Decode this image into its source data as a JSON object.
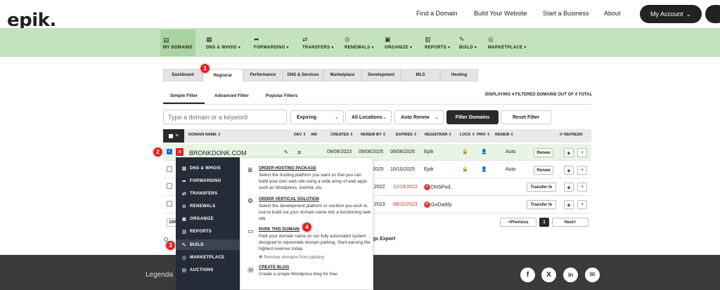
{
  "header": {
    "logo": "epik.",
    "links": [
      "Find a Domain",
      "Build Your Website",
      "Start a Business",
      "About"
    ],
    "account_button": "My Account",
    "account_chevron": "⌄"
  },
  "nav": {
    "items": [
      {
        "label": "MY DOMAINS",
        "icon": "▤"
      },
      {
        "label": "DNS & WHOIS ▾",
        "icon": "▦"
      },
      {
        "label": "FORWARDING ▾",
        "icon": "➦"
      },
      {
        "label": "TRANSFERS ▾",
        "icon": "⇄"
      },
      {
        "label": "RENEWALS ▾",
        "icon": "⊙"
      },
      {
        "label": "ORGANIZE ▾",
        "icon": "▣"
      },
      {
        "label": "REPORTS ▾",
        "icon": "▥"
      },
      {
        "label": "BUILD ▾",
        "icon": "✎"
      },
      {
        "label": "MARKETPLACE ▾",
        "icon": "◎"
      }
    ]
  },
  "tabs": [
    "Dashboard",
    "Registrar",
    "Performance",
    "DNS & Services",
    "Marketplace",
    "Development",
    "MLS",
    "Hosting"
  ],
  "subtabs": [
    "Simple Filter",
    "Advanced Filter",
    "Popular Filters"
  ],
  "displaying": "DISPLAYING 4 FILTERED DOMAINS OUT OF 4 TOTAL",
  "filters": {
    "search_placeholder": "Type a domain or a keyword",
    "expiring": "Expiring",
    "locations": "All Locations",
    "autorenew": "Auto Renew",
    "filter_button": "Filter Domains",
    "reset_button": "Reset Filter",
    "chev": "⌄"
  },
  "table": {
    "headers": {
      "domain": "DOMAIN NAME ⇕",
      "dev": "DEV ⇕",
      "am": "AM",
      "created": "CREATED ⇕",
      "renewby": "RENEW BY ⇕",
      "expires": "EXPIRES ⇕",
      "registrar": "REGISTRAR ⇕",
      "lock": "LOCK ⇕",
      "priv": "PRIV ⇕",
      "renew": "RENEW ⇕",
      "refresh": "⟳ REFRESH"
    },
    "rows": [
      {
        "domain": "BRONKDONK.COM",
        "created": "09/08/2023",
        "renewby": "09/08/2025",
        "expires": "09/08/2025",
        "registrar": "Epik",
        "renew": "Auto",
        "action": "Renew"
      },
      {
        "renewby": "2025",
        "expires": "10/10/2025",
        "registrar": "Epik",
        "renew": "Auto",
        "action": "Renew"
      },
      {
        "renewby": "2022",
        "expires": "12/19/2022",
        "registrar": "DNSPod,",
        "action": "Transfer In"
      },
      {
        "renewby": "2023",
        "expires": "08/11/2023",
        "registrar": "GoDaddy",
        "action": "Transfer In"
      }
    ],
    "tag_icon": "◈",
    "plus_icon": "+",
    "lock_icon": "🔒",
    "priv_icon": "👤",
    "server_icon": "≡",
    "edit_icon": "✎"
  },
  "pagination": {
    "per_page": "100",
    "prev": "<Previous",
    "page": "1",
    "next": "Next>"
  },
  "export": "gs Export",
  "footer": {
    "legend": "Legenda",
    "social": [
      "f",
      "X",
      "in",
      "✉"
    ]
  },
  "menu": {
    "items": [
      {
        "label": "DNS & WHOIS",
        "icon": "▦"
      },
      {
        "label": "FORWARDING",
        "icon": "➦"
      },
      {
        "label": "TRANSFERS",
        "icon": "⇄"
      },
      {
        "label": "RENEWALS",
        "icon": "⊙"
      },
      {
        "label": "ORGANIZE",
        "icon": "▣"
      },
      {
        "label": "REPORTS",
        "icon": "▥"
      },
      {
        "label": "BUILD",
        "icon": "✎"
      },
      {
        "label": "MARKETPLACE",
        "icon": "◎"
      },
      {
        "label": "AUCTIONS",
        "icon": "▤"
      }
    ],
    "options": [
      {
        "title": "ORDER HOSTING PACKAGE",
        "desc": "Select the hosting platform you want so that you can build your own web site using a wide array of web apps such as Wordpress, Joomla, etc.",
        "icon": "≣"
      },
      {
        "title": "ORDER VERTICAL SOLUTION",
        "desc": "Select the development platform or solution you wish to use to build out your domain name into a functioning web site",
        "icon": "⚙"
      },
      {
        "title": "PARK THIS DOMAIN",
        "desc": "Park your domain name on our fully automated system designed to rejuvenate domain parking. Start earning the highest revenue today.",
        "extra": "✖ Remove domains from parking",
        "icon": "▭"
      },
      {
        "title": "CREATE BLOG",
        "desc": "Create a simple Wordpress blog for free.",
        "icon": "Ⓦ"
      }
    ]
  },
  "callouts": [
    "1",
    "2",
    "3",
    "4"
  ]
}
